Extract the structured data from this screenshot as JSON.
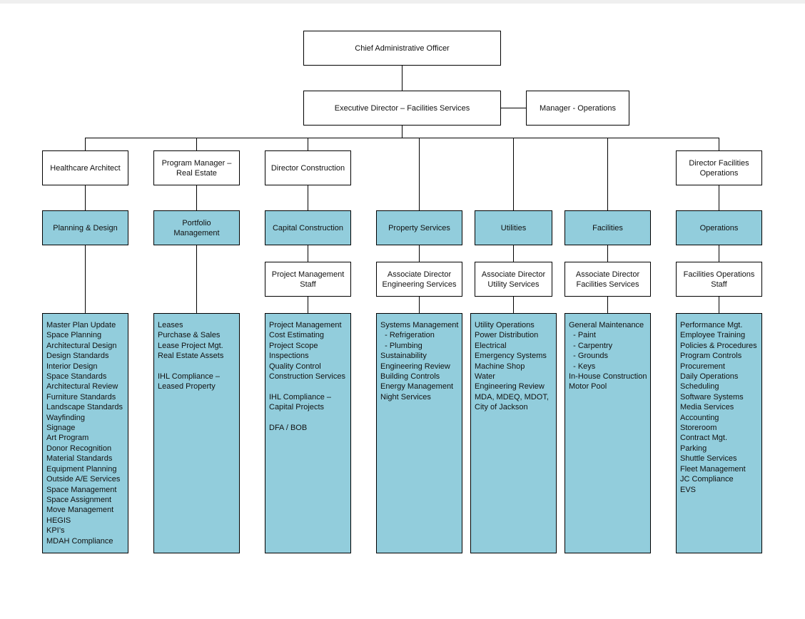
{
  "colors": {
    "unit_fill": "#92cddc",
    "box_fill": "#ffffff",
    "line": "#000000"
  },
  "top": {
    "cao": "Chief Administrative Officer",
    "exec": "Executive Director – Facilities Services",
    "ops_manager": "Manager - Operations"
  },
  "columns": [
    {
      "head": "Healthcare Architect",
      "unit": "Planning & Design",
      "sub": null,
      "items": [
        "Master Plan Update",
        "Space Planning",
        "Architectural Design",
        "Design Standards",
        "Interior Design",
        "Space Standards",
        "Architectural Review",
        "Furniture Standards",
        "Landscape Standards",
        "Wayfinding",
        "Signage",
        "Art Program",
        "Donor Recognition",
        "Material Standards",
        "Equipment Planning",
        "Outside A/E Services",
        "Space Management",
        "Space Assignment",
        "Move Management",
        "HEGIS",
        "KPI’s",
        "MDAH Compliance"
      ]
    },
    {
      "head": "Program Manager –\nReal Estate",
      "unit": "Portfolio\nManagement",
      "sub": null,
      "items": [
        "Leases",
        "Purchase & Sales",
        "Lease Project Mgt.",
        "Real Estate Assets",
        "",
        "IHL Compliance –",
        "Leased Property"
      ]
    },
    {
      "head": "Director Construction",
      "unit": "Capital Construction",
      "sub": "Project Management\nStaff",
      "items": [
        "Project Management",
        "Cost Estimating",
        "Project Scope",
        "Inspections",
        "Quality Control",
        "Construction Services",
        "",
        "IHL Compliance –",
        "Capital Projects",
        "",
        "DFA / BOB"
      ]
    },
    {
      "head": null,
      "unit": "Property Services",
      "sub": "Associate Director\nEngineering Services",
      "items": [
        "Systems Management",
        "  - Refrigeration",
        "  - Plumbing",
        "Sustainability",
        "Engineering Review",
        "Building Controls",
        "Energy Management",
        "Night Services"
      ]
    },
    {
      "head": null,
      "unit": "Utilities",
      "sub": "Associate Director\nUtility Services",
      "items": [
        "Utility Operations",
        "Power Distribution",
        "Electrical",
        "Emergency Systems",
        "Machine Shop",
        "Water",
        "Engineering Review",
        "MDA, MDEQ, MDOT,",
        "City of Jackson"
      ]
    },
    {
      "head": null,
      "unit": "Facilities",
      "sub": "Associate Director\nFacilities Services",
      "items": [
        "General Maintenance",
        "  - Paint",
        "  - Carpentry",
        "  - Grounds",
        "  - Keys",
        "In-House Construction",
        "Motor Pool"
      ]
    },
    {
      "head": "Director Facilities\nOperations",
      "unit": "Operations",
      "sub": "Facilities Operations\nStaff",
      "items": [
        "Performance Mgt.",
        "Employee Training",
        "Policies & Procedures",
        "Program Controls",
        "Procurement",
        "Daily Operations",
        "Scheduling",
        "Software Systems",
        "Media Services",
        "Accounting",
        "Storeroom",
        "Contract Mgt.",
        "Parking",
        "Shuttle Services",
        "Fleet Management",
        "JC Compliance",
        "EVS"
      ]
    }
  ]
}
